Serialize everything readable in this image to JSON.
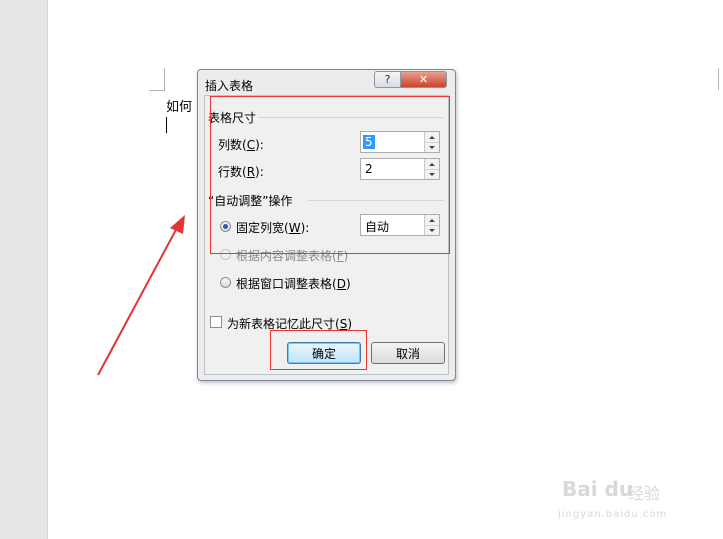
{
  "document": {
    "visible_text": "如何"
  },
  "dialog": {
    "title": "插入表格",
    "help_button": "?",
    "close_button": "✕",
    "table_size_group": "表格尺寸",
    "columns": {
      "label": "列数(",
      "key": "C",
      "suffix": "):",
      "value": "5"
    },
    "rows": {
      "label": "行数(",
      "key": "R",
      "suffix": "):",
      "value": "2"
    },
    "autofit_group": "“自动调整”操作",
    "fixed_width": {
      "label": "固定列宽(",
      "key": "W",
      "suffix": "):",
      "value": "自动",
      "selected": true
    },
    "autofit_contents": {
      "label": "根据内容调整表格(",
      "key": "F",
      "suffix": ")"
    },
    "autofit_window": {
      "label": "根据窗口调整表格(",
      "key": "D",
      "suffix": ")"
    },
    "remember": {
      "label": "为新表格记忆此尺寸(",
      "key": "S",
      "suffix": ")",
      "checked": false
    },
    "ok_button": "确定",
    "cancel_button": "取消"
  },
  "watermark": {
    "logo": "Bai du",
    "text": "经验",
    "url": "jingyan.baidu.com"
  },
  "colors": {
    "annotation_red": "#e33333",
    "selection_blue": "#3399ff",
    "default_button_border": "#3c7fb1"
  }
}
